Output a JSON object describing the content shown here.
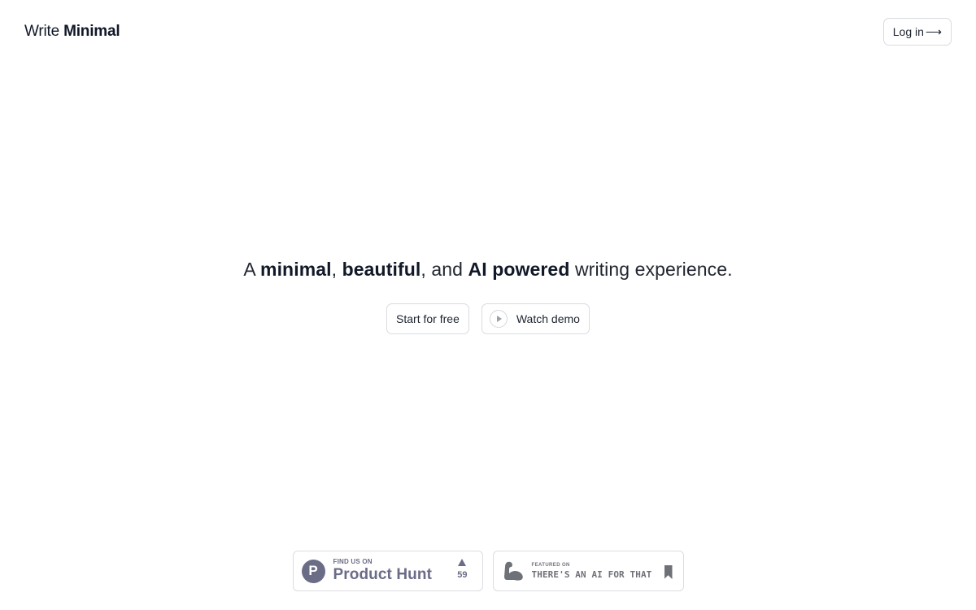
{
  "header": {
    "logo_light": "Write ",
    "logo_bold": "Minimal",
    "login_label": "Log in",
    "login_arrow": "⟶"
  },
  "hero": {
    "parts": {
      "p1": "A ",
      "b1": "minimal",
      "p2": ", ",
      "b2": "beautiful",
      "p3": ", and ",
      "b3": "AI powered",
      "p4": " writing experience."
    },
    "start_label": "Start for free",
    "demo_label": "Watch demo",
    "demo_icon": "play-icon"
  },
  "badges": {
    "product_hunt": {
      "small": "FIND US ON",
      "big": "Product Hunt",
      "logo_letter": "P",
      "votes": "59",
      "color": "#6b6c86"
    },
    "ai_for_that": {
      "small": "FEATURED ON",
      "big": "THERE'S AN AI FOR THAT",
      "icon": "flexed-arm-icon",
      "bookmark_icon": "bookmark-icon",
      "color": "#6f7178"
    }
  }
}
